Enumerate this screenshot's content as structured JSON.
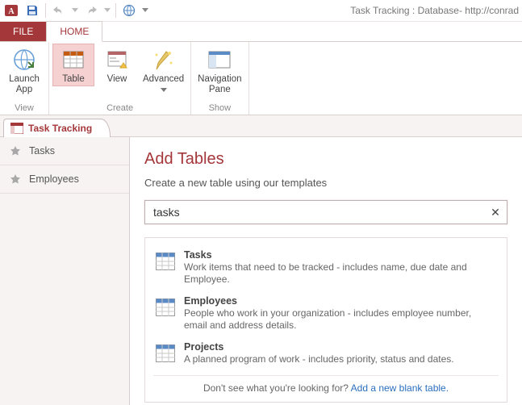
{
  "app_title": "Task Tracking : Database- http://conrad",
  "tabs": {
    "file": "FILE",
    "home": "HOME"
  },
  "ribbon": {
    "launch_app": "Launch\nApp",
    "table": "Table",
    "view": "View",
    "advanced": "Advanced",
    "nav_pane": "Navigation\nPane",
    "group_view": "View",
    "group_create": "Create",
    "group_show": "Show"
  },
  "doctab": "Task Tracking",
  "sidebar": {
    "items": [
      {
        "label": "Tasks"
      },
      {
        "label": "Employees"
      }
    ]
  },
  "main": {
    "heading": "Add Tables",
    "subtitle": "Create a new table using our templates",
    "search_value": "tasks",
    "results": [
      {
        "title": "Tasks",
        "desc": "Work items that need to be tracked - includes name, due date and Employee."
      },
      {
        "title": "Employees",
        "desc": "People who work in your organization - includes employee number, email and address details."
      },
      {
        "title": "Projects",
        "desc": "A planned program of work - includes priority, status and dates."
      }
    ],
    "footer_text": "Don't see what you're looking for?  ",
    "footer_link": "Add a new blank table."
  }
}
